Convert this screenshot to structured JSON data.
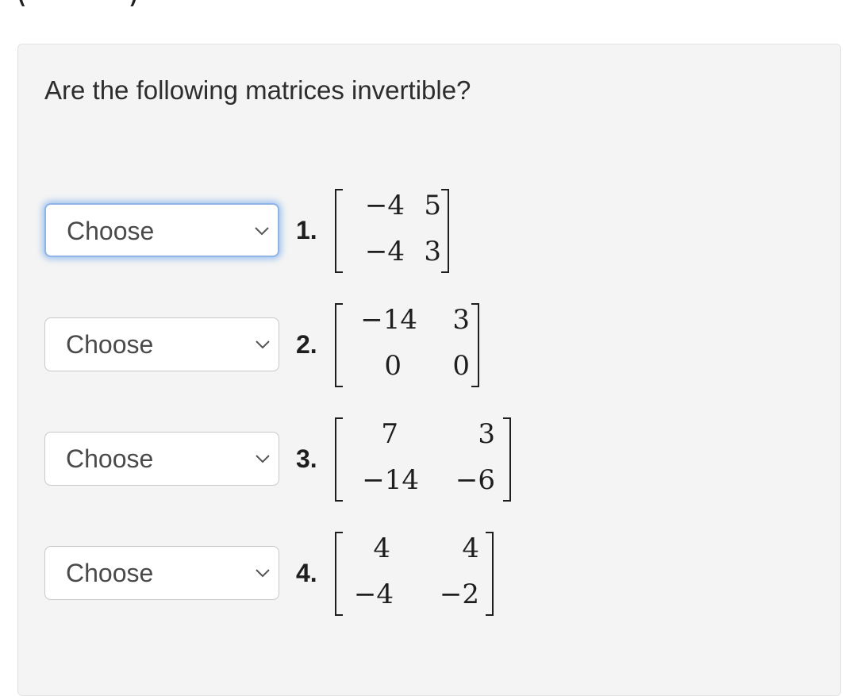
{
  "question": "Are the following matrices invertible?",
  "select_placeholder": "Choose",
  "items": [
    {
      "number": "1.",
      "matrix": [
        [
          "−4",
          "5"
        ],
        [
          "−4",
          "3"
        ]
      ]
    },
    {
      "number": "2.",
      "matrix": [
        [
          "−14",
          "3"
        ],
        [
          "0",
          "0"
        ]
      ]
    },
    {
      "number": "3.",
      "matrix": [
        [
          "7",
          "3"
        ],
        [
          "−14",
          "−6"
        ]
      ]
    },
    {
      "number": "4.",
      "matrix": [
        [
          "4",
          "4"
        ],
        [
          "−4",
          "−2"
        ]
      ]
    }
  ],
  "icons": {
    "dropdown": "chevron-down-icon"
  }
}
